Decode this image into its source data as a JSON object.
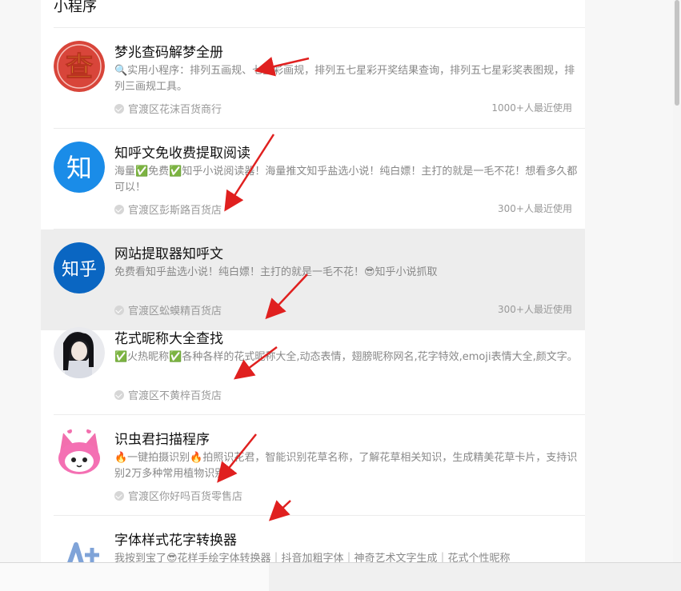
{
  "section_title": "小程序",
  "items": [
    {
      "name": "梦兆查码解梦全册",
      "desc": "🔍实用小程序：排列五画规、七星彩画规，排列五七星彩开奖结果查询，排列五七星彩奖表图规，排列三画规工具。",
      "shop": "官渡区花沫百货商行",
      "usage": "1000+人最近使用",
      "avatar_text": "查",
      "avatar_icon": "cha-logo-icon"
    },
    {
      "name": "知呼文免收费提取阅读",
      "desc": "海量✅免费✅知乎小说阅读器！海量推文知乎盐选小说！纯白嫖！主打的就是一毛不花！想看多久都可以！",
      "shop": "官渡区彭斯路百货店",
      "usage": "300+人最近使用",
      "avatar_text": "知",
      "avatar_icon": "zhi-logo-icon"
    },
    {
      "name": "网站提取器知呼文",
      "desc": "免费看知乎盐选小说！纯白嫖！主打的就是一毛不花！😎知乎小说抓取",
      "shop": "官渡区蚣蟆精百货店",
      "usage": "300+人最近使用",
      "avatar_text": "知乎",
      "avatar_icon": "zhihu-logo-icon"
    },
    {
      "name": "花式昵称大全查找",
      "desc": "✅火热昵称✅各种各样的花式昵称大全,动态表情，翅膀昵称网名,花字特效,emoji表情大全,颜文字。",
      "shop": "官渡区不黄梓百货店",
      "usage": "",
      "avatar_text": "",
      "avatar_icon": "girl-photo-icon"
    },
    {
      "name": "识虫君扫描程序",
      "desc": "🔥一键拍摄识别🔥拍照识花君，智能识别花草名称，了解花草相关知识，生成精美花草卡片，支持识别2万多种常用植物识别。",
      "shop": "官渡区你好吗百货零售店",
      "usage": "",
      "avatar_text": "",
      "avatar_icon": "pink-cat-icon"
    },
    {
      "name": "字体样式花字转换器",
      "desc": "我按到宝了😎花样手绘字体转换器｜抖音加粗字体｜神奇艺术文字生成｜花式个性昵称",
      "shop": "",
      "usage": "",
      "avatar_text": "A+",
      "avatar_icon": "font-a-plus-icon"
    }
  ],
  "colors": {
    "accent_red": "#e0201f",
    "zhi_blue": "#1a8ce8",
    "zhihu_blue": "#0a66c2",
    "cha_red": "#d8453a",
    "cha_yellow": "#f5d02c"
  }
}
